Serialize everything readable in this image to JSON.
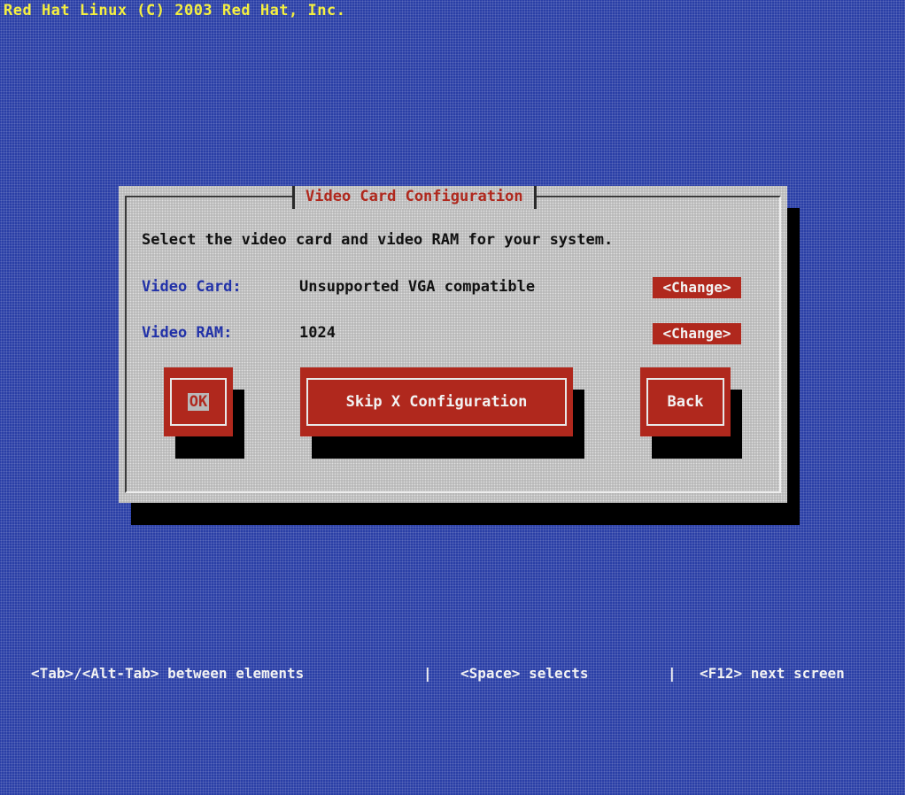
{
  "header": {
    "title": "Red Hat Linux (C) 2003 Red Hat, Inc."
  },
  "dialog": {
    "title": "Video Card Configuration",
    "instructions": "Select the video card and video RAM for your system.",
    "video_card": {
      "label": "Video Card:",
      "value": "Unsupported VGA compatible",
      "change_label": "<Change>"
    },
    "video_ram": {
      "label": "Video RAM:",
      "value": "1024",
      "change_label": "<Change>"
    },
    "buttons": {
      "ok": "OK",
      "skip": "Skip X Configuration",
      "back": "Back"
    }
  },
  "status_bar": {
    "tab_hint": "<Tab>/<Alt-Tab> between elements",
    "sep1": "|",
    "space_hint": "<Space> selects",
    "sep2": "|",
    "f12_hint": "<F12> next screen"
  },
  "colors": {
    "background": "#2a3fa6",
    "dialog": "#b9b9b9",
    "accent_red": "#b0281d",
    "title_yellow": "#f4ef40",
    "label_blue": "#2232a8"
  }
}
